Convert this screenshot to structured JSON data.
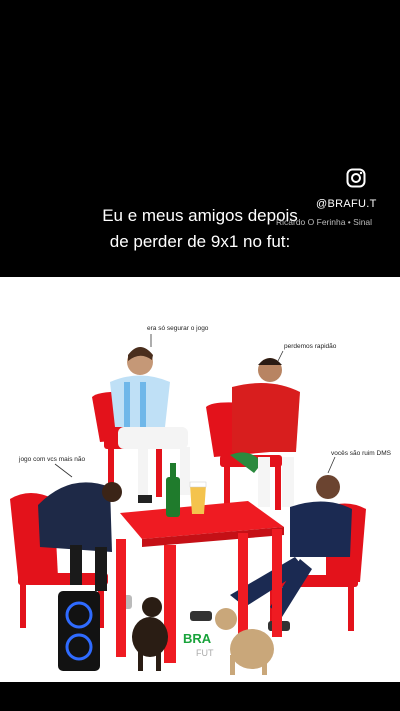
{
  "header": {
    "handle": "@BRAFU.T",
    "music": "Ricardo O Ferinha • Sinal",
    "caption_line1": "Eu e meus amigos depois",
    "caption_line2": "de perder de 9x1 no fut:"
  },
  "scene": {
    "labels": {
      "top_center": "era só segurar o jogo",
      "top_right": "perdemos rapidão",
      "left": "jogo com vcs mais não",
      "right": "vocês são ruim DMS"
    },
    "logo_main": "BRA",
    "logo_sub": "FUT"
  },
  "colors": {
    "background": "#000000",
    "scene_bg": "#ffffff",
    "chair_red": "#e3121b",
    "table_red": "#ef1b22"
  },
  "icons": [
    "instagram-icon"
  ]
}
